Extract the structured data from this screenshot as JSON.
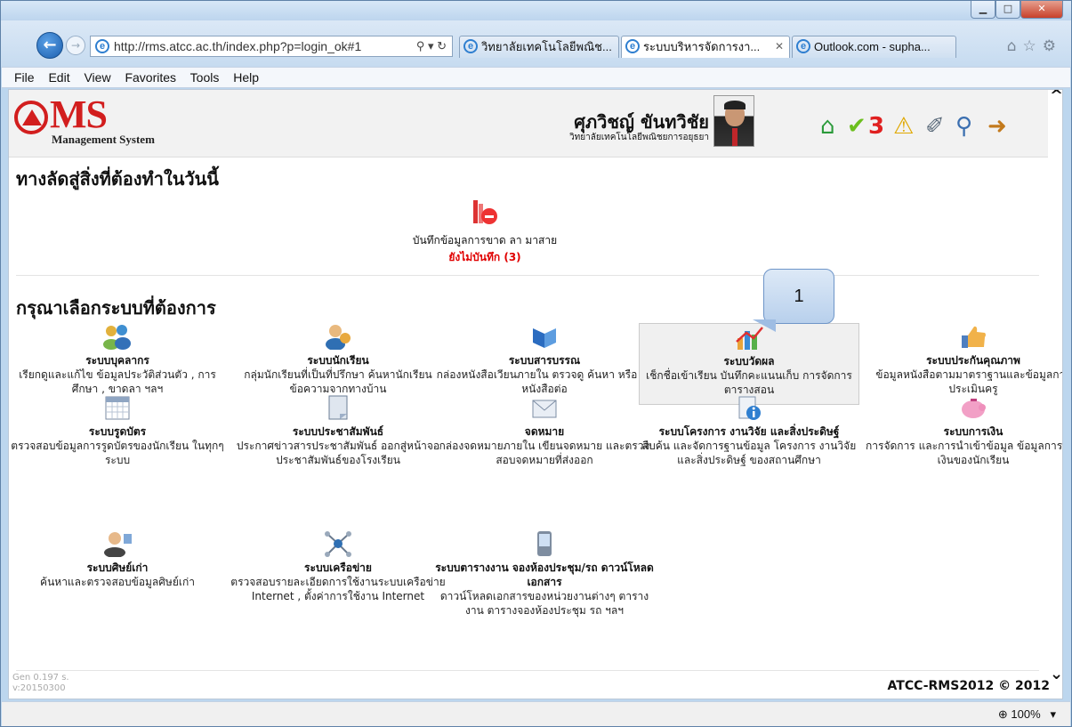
{
  "browser": {
    "address": "http://rms.atcc.ac.th/index.php?p=login_ok#1",
    "tabs": [
      {
        "label": "วิทยาลัยเทคโนโลยีพณิช..."
      },
      {
        "label": "ระบบบริหารจัดการงา..."
      },
      {
        "label": "Outlook.com - supha..."
      }
    ],
    "menu": [
      "File",
      "Edit",
      "View",
      "Favorites",
      "Tools",
      "Help"
    ],
    "zoom": "100%"
  },
  "header": {
    "logo_text": "MS",
    "logo_sub": "Management System",
    "user_name": "ศุภวิชญ์ ขันทวิชัย",
    "user_org": "วิทยาลัยเทคโนโลยีพณิชยการอยุธยา",
    "notify_count": "3"
  },
  "shortcuts": {
    "title": "ทางลัดสู่สิ่งที่ต้องทำในวันนี้",
    "item_label": "บันทึกข้อมูลการขาด ลา มาสาย",
    "item_status": "ยังไม่บันทึก (3)"
  },
  "systems": {
    "title": "กรุณาเลือกระบบที่ต้องการ",
    "items": [
      {
        "title": "ระบบบุคลากร",
        "desc": "เรียกดูและแก้ไข ข้อมูลประวัติส่วนตัว , การศึกษา , ขาดลา ฯลฯ"
      },
      {
        "title": "ระบบนักเรียน",
        "desc": "กลุ่มนักเรียนที่เป็นที่ปรึกษา ค้นหานักเรียน ข้อความจากทางบ้าน"
      },
      {
        "title": "ระบบสารบรรณ",
        "desc": "กล่องหนังสือเวียนภายใน ตรวจดู ค้นหา หรือ ส่งหนังสือต่อ"
      },
      {
        "title": "ระบบวัดผล",
        "desc": "เช็กชื่อเข้าเรียน บันทึกคะแนนเก็บ การจัดการตารางสอน"
      },
      {
        "title": "ระบบประกันคุณภาพ",
        "desc": "ข้อมูลหนังสือตามมาตราฐานและข้อมูลการประเมินครู"
      },
      {
        "title": "ระบบรูดบัตร",
        "desc": "ตรวจสอบข้อมูลการรูดบัตรของนักเรียน ในทุกๆ ระบบ"
      },
      {
        "title": "ระบบประชาสัมพันธ์",
        "desc": "ประกาศข่าวสารประชาสัมพันธ์ ออกสู่หน้าจอประชาสัมพันธ์ของโรงเรียน"
      },
      {
        "title": "จดหมาย",
        "desc": "กล่องจดหมายภายใน เขียนจดหมาย และตรวจสอบจดหมายที่ส่งออก"
      },
      {
        "title": "ระบบโครงการ งานวิจัย และสิ่งประดิษฐ์",
        "desc": "สืบค้น และจัดการฐานข้อมูล โครงการ งานวิจัย และสิ่งประดิษฐ์ ของสถานศึกษา"
      },
      {
        "title": "ระบบการเงิน",
        "desc": "การจัดการ และการนำเข้าข้อมูล ข้อมูลการจ่ายเงินของนักเรียน"
      },
      {
        "title": "ระบบศิษย์เก่า",
        "desc": "ค้นหาและตรวจสอบข้อมูลศิษย์เก่า"
      },
      {
        "title": "ระบบเครือข่าย",
        "desc": "ตรวจสอบรายละเอียดการใช้งานระบบเครือข่าย Internet , ตั้งค่าการใช้งาน Internet"
      },
      {
        "title": "ระบบตารางงาน จองห้องประชุม/รถ ดาวน์โหลดเอกสาร",
        "desc": "ดาวน์โหลดเอกสารของหน่วยงานต่างๆ ตารางงาน ตารางจองห้องประชุม รถ ฯลฯ"
      }
    ]
  },
  "callout": "1",
  "footer": {
    "gen": "Gen 0.197 s.",
    "version": "v:20150300",
    "copyright": "ATCC-RMS2012 © 2012"
  }
}
